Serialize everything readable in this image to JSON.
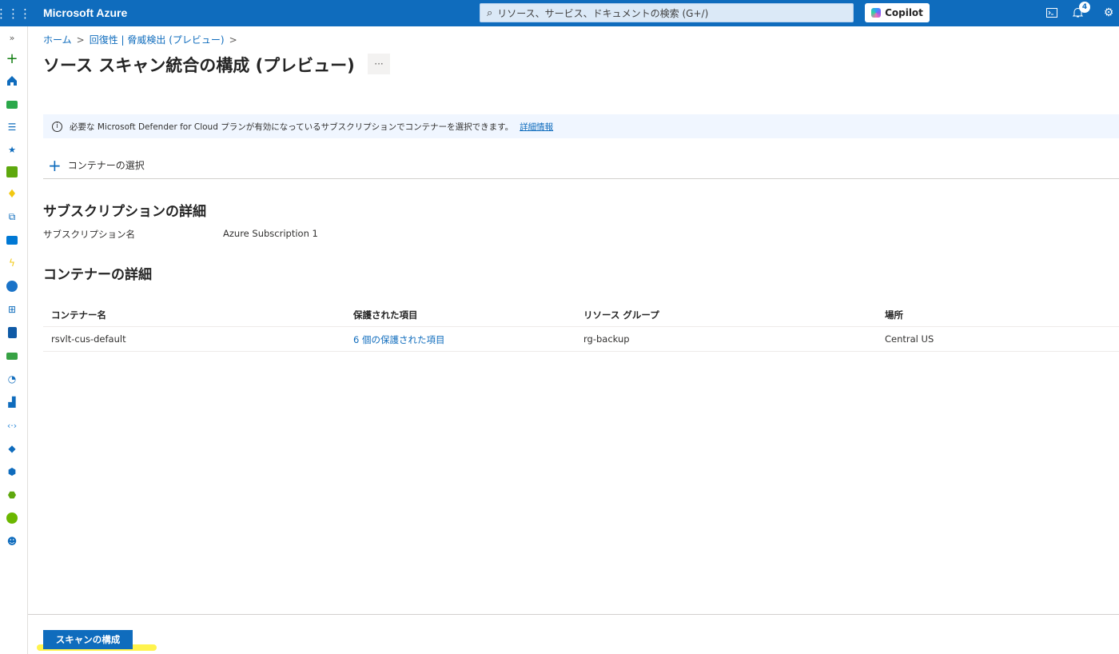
{
  "topbar": {
    "brand": "Microsoft Azure",
    "search_placeholder": "リソース、サービス、ドキュメントの検索 (G+/)",
    "copilot_label": "Copilot",
    "notification_count": "4"
  },
  "breadcrumb": {
    "home": "ホーム",
    "parent": "回復性 | 脅威検出 (プレビュー)",
    "sep": ">"
  },
  "page": {
    "title": "ソース スキャン統合の構成 (プレビュー)",
    "more_label": "···"
  },
  "info": {
    "icon": "i",
    "text": "必要な Microsoft Defender for Cloud プランが有効になっているサブスクリプションでコンテナーを選択できます。",
    "link": "詳細情報"
  },
  "toolbar": {
    "select_container_label": "コンテナーの選択"
  },
  "subscription": {
    "heading": "サブスクリプションの詳細",
    "name_label": "サブスクリプション名",
    "name_value": "Azure Subscription 1"
  },
  "containers": {
    "heading": "コンテナーの詳細",
    "columns": [
      "コンテナー名",
      "保護された項目",
      "リソース グループ",
      "場所"
    ],
    "rows": [
      [
        "rsvlt-cus-default",
        "6 個の保護された項目",
        "rg-backup",
        "Central US"
      ]
    ]
  },
  "footer": {
    "configure_button": "スキャンの構成"
  },
  "rail_icons": [
    "expand-icon",
    "create-icon",
    "home-icon",
    "dashboard-icon",
    "all-services-icon",
    "favorites-icon",
    "all-resources-icon",
    "key-vault-icon",
    "container-icon",
    "virtual-machine-icon",
    "function-app-icon",
    "cosmos-db-icon",
    "network-icon",
    "sql-icon",
    "storage-icon",
    "monitor-icon",
    "app-service-icon",
    "virtual-network-icon",
    "entra-id-icon",
    "defender-icon",
    "security-icon",
    "advisor-icon",
    "support-icon"
  ],
  "colors": {
    "accent": "#0f6cbd",
    "info_bg": "#f0f6ff",
    "highlight": "#fff23a"
  }
}
